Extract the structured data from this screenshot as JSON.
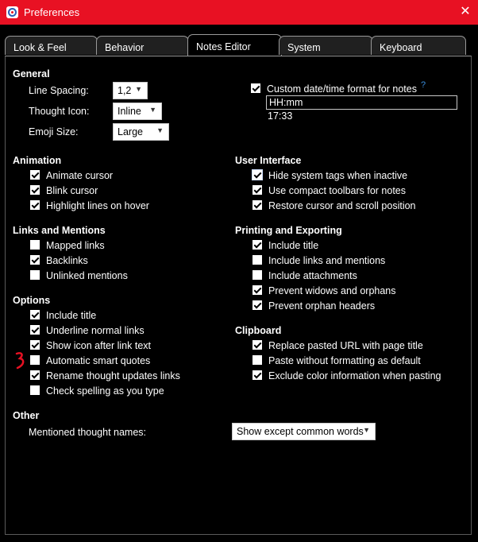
{
  "window": {
    "title": "Preferences",
    "close_glyph": "✕",
    "titlebar_color": "#e81123",
    "icon": "app-logo-icon"
  },
  "tabs": [
    {
      "label": "Look & Feel",
      "active": false
    },
    {
      "label": "Behavior",
      "active": false
    },
    {
      "label": "Notes Editor",
      "active": true
    },
    {
      "label": "System",
      "active": false
    },
    {
      "label": "Keyboard",
      "active": false
    }
  ],
  "general": {
    "heading": "General",
    "line_spacing": {
      "label": "Line Spacing:",
      "value": "1,2"
    },
    "thought_icon": {
      "label": "Thought Icon:",
      "value": "Inline"
    },
    "emoji_size": {
      "label": "Emoji Size:",
      "value": "Large"
    },
    "custom_date": {
      "label": "Custom date/time format for notes",
      "checked": true,
      "help": "?",
      "format_value": "HH:mm",
      "preview": "17:33"
    }
  },
  "animation": {
    "heading": "Animation",
    "items": [
      {
        "label": "Animate cursor",
        "checked": true
      },
      {
        "label": "Blink cursor",
        "checked": true
      },
      {
        "label": "Highlight lines on hover",
        "checked": true
      }
    ]
  },
  "user_interface": {
    "heading": "User Interface",
    "items": [
      {
        "label": "Hide system tags when inactive",
        "checked": true
      },
      {
        "label": "Use compact toolbars for notes",
        "checked": true
      },
      {
        "label": "Restore cursor and scroll position",
        "checked": true
      }
    ]
  },
  "links": {
    "heading": "Links and Mentions",
    "items": [
      {
        "label": "Mapped links",
        "checked": false
      },
      {
        "label": "Backlinks",
        "checked": true
      },
      {
        "label": "Unlinked mentions",
        "checked": false
      }
    ]
  },
  "printing": {
    "heading": "Printing and Exporting",
    "items": [
      {
        "label": "Include title",
        "checked": true
      },
      {
        "label": "Include links and mentions",
        "checked": false
      },
      {
        "label": "Include attachments",
        "checked": false
      },
      {
        "label": "Prevent widows and orphans",
        "checked": true
      },
      {
        "label": "Prevent orphan headers",
        "checked": true
      }
    ]
  },
  "options": {
    "heading": "Options",
    "items": [
      {
        "label": "Include title",
        "checked": true
      },
      {
        "label": "Underline normal links",
        "checked": true
      },
      {
        "label": "Show icon after link text",
        "checked": true
      },
      {
        "label": "Automatic smart quotes",
        "checked": false
      },
      {
        "label": "Rename thought updates links",
        "checked": true
      },
      {
        "label": "Check spelling as you type",
        "checked": false
      }
    ]
  },
  "clipboard": {
    "heading": "Clipboard",
    "items": [
      {
        "label": "Replace pasted URL with page title",
        "checked": true
      },
      {
        "label": "Paste without formatting as default",
        "checked": false
      },
      {
        "label": "Exclude color information when pasting",
        "checked": true
      }
    ]
  },
  "other": {
    "heading": "Other",
    "mentioned_label": "Mentioned thought names:",
    "mentioned_value": "Show except common words"
  },
  "annotation": {
    "color": "#e81123"
  }
}
